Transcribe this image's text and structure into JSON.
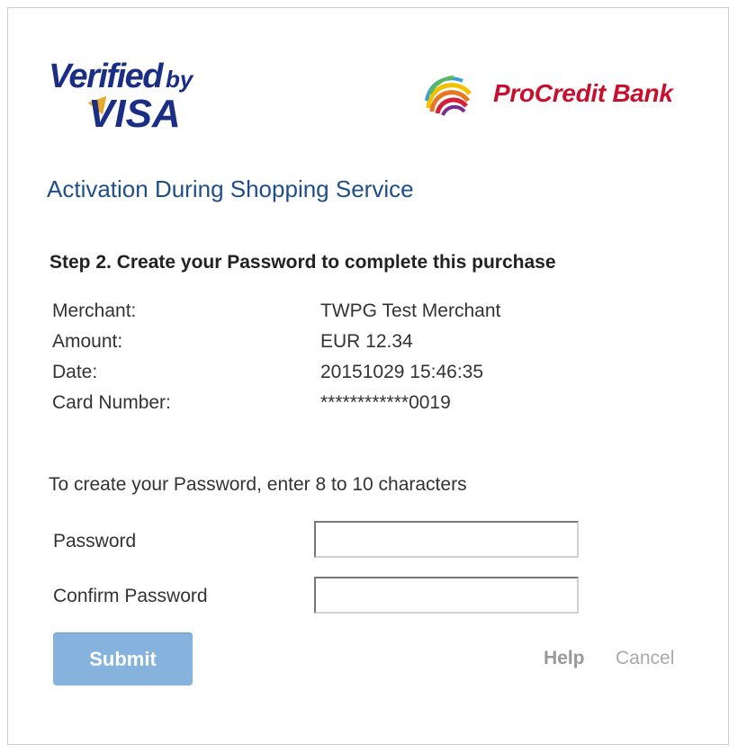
{
  "brand": {
    "vbv_line1": "Verified",
    "vbv_by": "by",
    "vbv_line2": "VISA",
    "bank_name": "ProCredit Bank",
    "bank_color": "#c8102e",
    "visa_color": "#1a2e86"
  },
  "page": {
    "title": "Activation During Shopping Service",
    "step": "Step 2. Create your Password to complete this purchase",
    "hint": "To create your Password, enter 8 to 10 characters"
  },
  "details": [
    {
      "label": "Merchant:",
      "value": "TWPG Test Merchant"
    },
    {
      "label": "Amount:",
      "value": "EUR 12.34"
    },
    {
      "label": "Date:",
      "value": "20151029 15:46:35"
    },
    {
      "label": "Card Number:",
      "value": "************0019"
    }
  ],
  "form": {
    "password_label": "Password",
    "password_value": "",
    "confirm_label": "Confirm Password",
    "confirm_value": ""
  },
  "actions": {
    "submit": "Submit",
    "help": "Help",
    "cancel": "Cancel"
  },
  "colors": {
    "title": "#1f4e8c",
    "submit_bg": "#85b3dd"
  }
}
